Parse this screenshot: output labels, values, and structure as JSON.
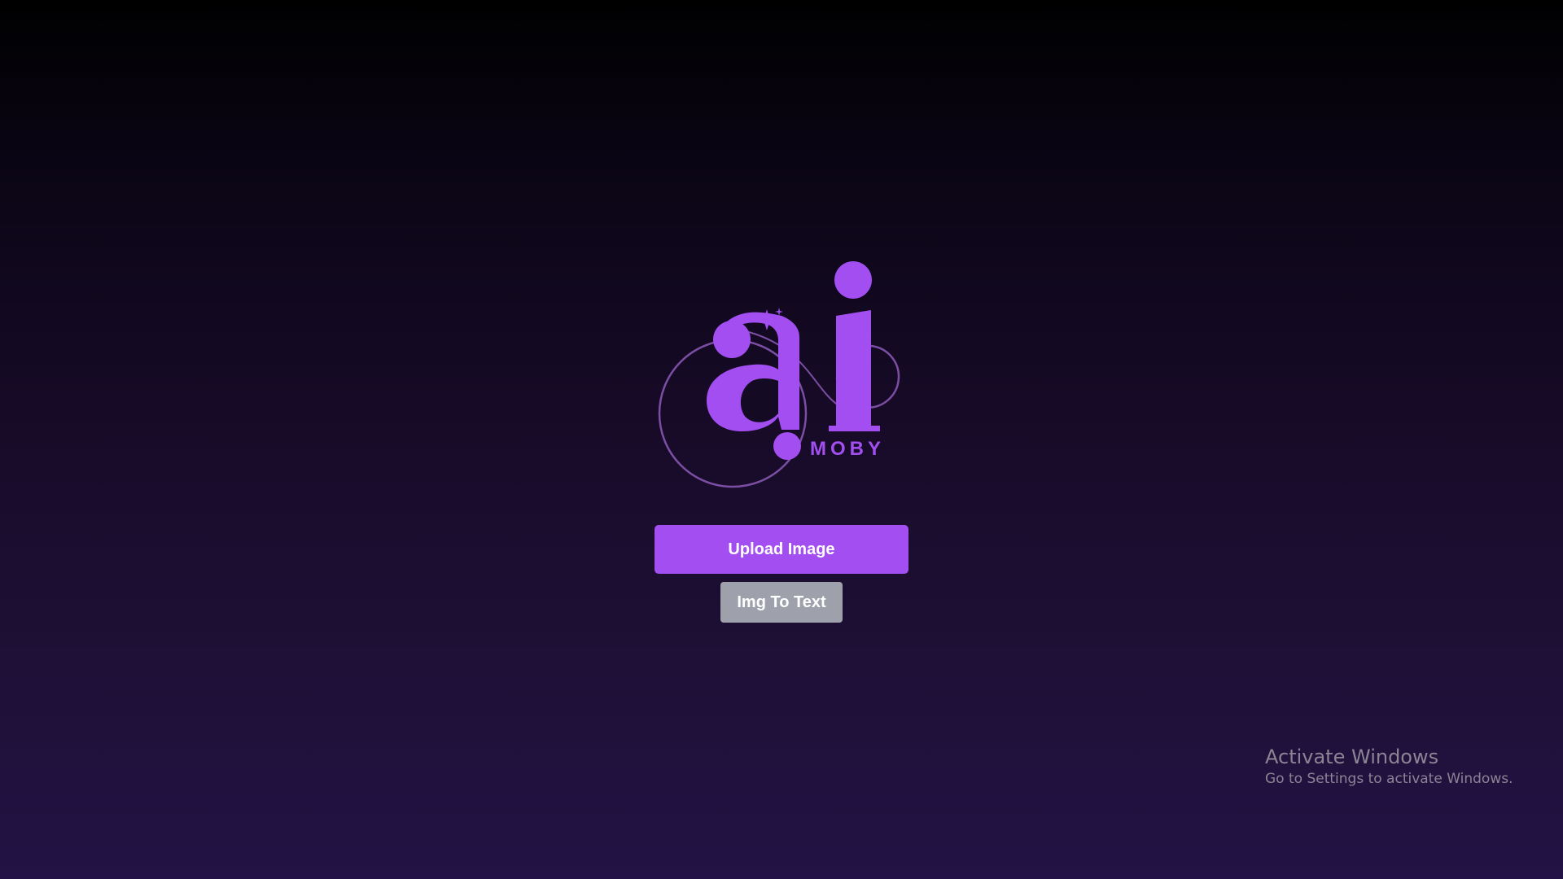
{
  "logo": {
    "icon": "ai-moby-logo",
    "brand_text": "MOBY",
    "color": "#a24ef0"
  },
  "actions": {
    "upload_label": "Upload Image",
    "img_to_text_label": "Img To Text"
  },
  "watermark": {
    "title": "Activate Windows",
    "subtitle": "Go to Settings to activate Windows."
  },
  "colors": {
    "accent": "#a24ef0",
    "secondary_button": "#9ea1ab",
    "background_top": "#000000",
    "background_bottom": "#231245"
  }
}
